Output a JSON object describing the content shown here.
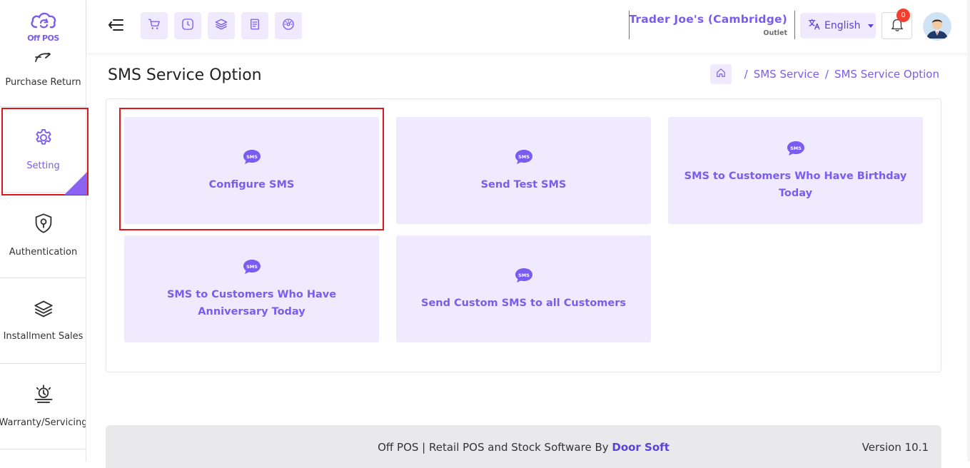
{
  "app": {
    "logo_text": "Off POS",
    "brand_color": "#7a5cf0"
  },
  "sidebar": {
    "items": [
      {
        "label": "Purchase Return",
        "icon": "return-arrow-icon"
      },
      {
        "label": "Setting",
        "icon": "gear-icon",
        "active": true
      },
      {
        "label": "Authentication",
        "icon": "shield-key-icon"
      },
      {
        "label": "Installment Sales",
        "icon": "layers-icon"
      },
      {
        "label": "Warranty/Servicing",
        "icon": "service-icon"
      }
    ]
  },
  "header": {
    "quick_actions": [
      "cart-icon",
      "clock-icon",
      "layers-icon",
      "receipt-icon",
      "dashboard-gauge-icon"
    ],
    "outlet_name": "Trader Joe's (Cambridge)",
    "outlet_type": "Outlet",
    "language": "English",
    "notification_count": "0"
  },
  "page": {
    "title": "SMS Service Option",
    "breadcrumb": [
      "SMS Service",
      "SMS Service Option"
    ]
  },
  "cards": [
    {
      "label": "Configure SMS",
      "icon": "sms-icon"
    },
    {
      "label": "Send Test SMS",
      "icon": "sms-icon"
    },
    {
      "label": "SMS to Customers Who Have Birthday Today",
      "icon": "sms-icon"
    },
    {
      "label": "SMS to Customers Who Have Anniversary Today",
      "icon": "sms-icon"
    },
    {
      "label": "Send Custom SMS to all Customers",
      "icon": "sms-icon"
    }
  ],
  "footer": {
    "text": "Off POS | Retail POS and Stock Software By ",
    "link": "Door Soft",
    "version": "Version 10.1"
  }
}
